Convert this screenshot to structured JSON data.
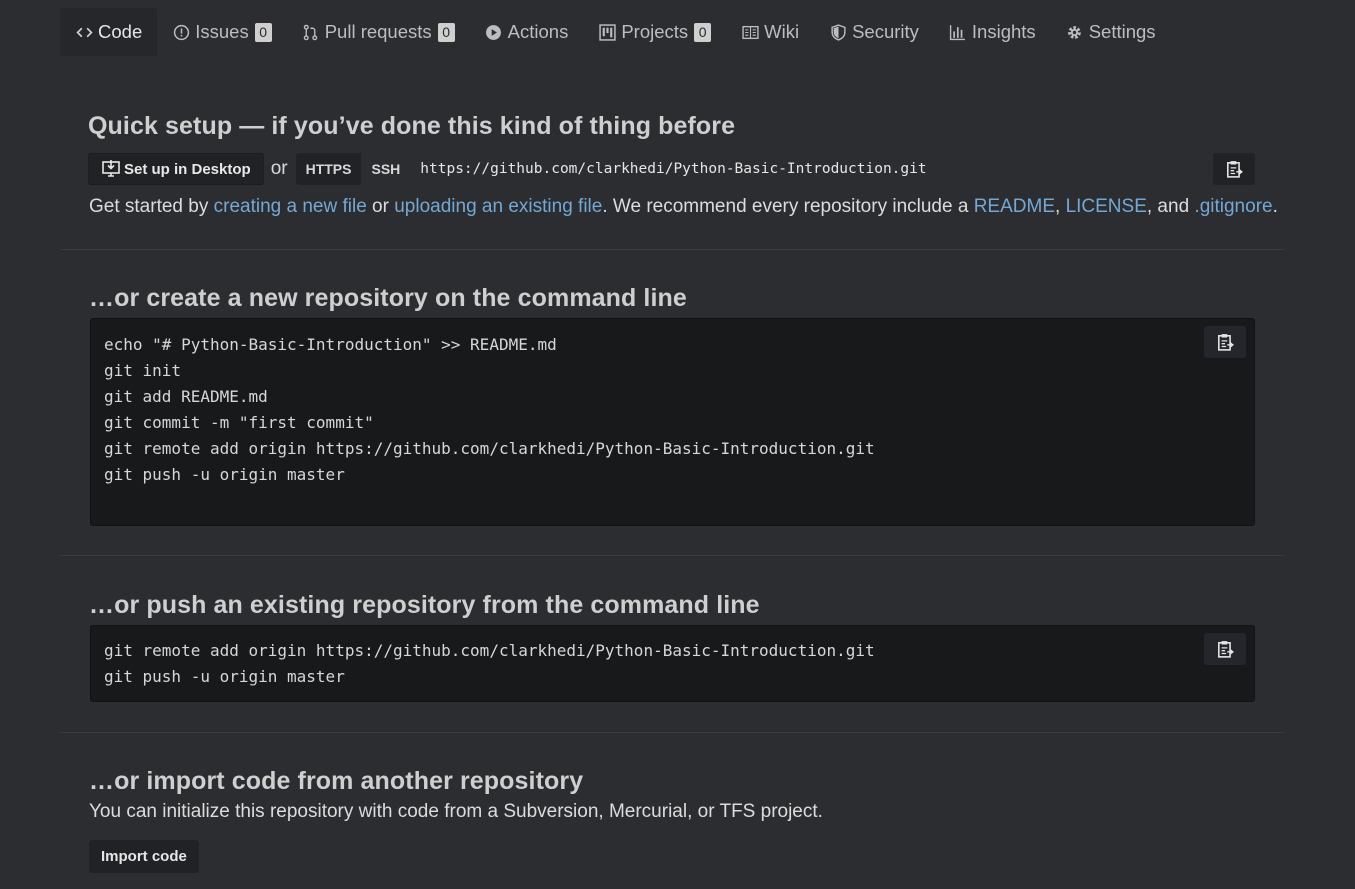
{
  "tabs": [
    {
      "label": "Code",
      "icon": "code-icon",
      "selected": true
    },
    {
      "label": "Issues",
      "icon": "issue-icon",
      "count": "0"
    },
    {
      "label": "Pull requests",
      "icon": "pull-request-icon",
      "count": "0"
    },
    {
      "label": "Actions",
      "icon": "play-icon"
    },
    {
      "label": "Projects",
      "icon": "project-icon",
      "count": "0"
    },
    {
      "label": "Wiki",
      "icon": "book-icon"
    },
    {
      "label": "Security",
      "icon": "shield-icon"
    },
    {
      "label": "Insights",
      "icon": "graph-icon"
    },
    {
      "label": "Settings",
      "icon": "gear-icon"
    }
  ],
  "quick_setup": {
    "title": "Quick setup — if you’ve done this kind of thing before",
    "desktop_button": "Set up in Desktop",
    "or": "or",
    "https": "HTTPS",
    "ssh": "SSH",
    "clone_url": "https://github.com/clarkhedi/Python-Basic-Introduction.git",
    "started_prefix": "Get started by ",
    "link_new_file": "creating a new file",
    "or_2": " or ",
    "link_upload": "uploading an existing file",
    "recommend": ". We recommend every repository include a ",
    "link_readme": "README",
    "comma": ", ",
    "link_license": "LICENSE",
    "and": ", and ",
    "link_gitignore": ".gitignore",
    "period": "."
  },
  "create_repo": {
    "title": "…or create a new repository on the command line",
    "code": "echo \"# Python-Basic-Introduction\" >> README.md\ngit init\ngit add README.md\ngit commit -m \"first commit\"\ngit remote add origin https://github.com/clarkhedi/Python-Basic-Introduction.git\ngit push -u origin master"
  },
  "push_repo": {
    "title": "…or push an existing repository from the command line",
    "code": "git remote add origin https://github.com/clarkhedi/Python-Basic-Introduction.git\ngit push -u origin master"
  },
  "import_repo": {
    "title": "…or import code from another repository",
    "description": "You can initialize this repository with code from a Subversion, Mercurial, or TFS project.",
    "button": "Import code"
  },
  "colors": {
    "background": "#2c2d31",
    "code_background": "#18191b",
    "link": "#74a8d4",
    "counter": "#cfcfcf"
  }
}
